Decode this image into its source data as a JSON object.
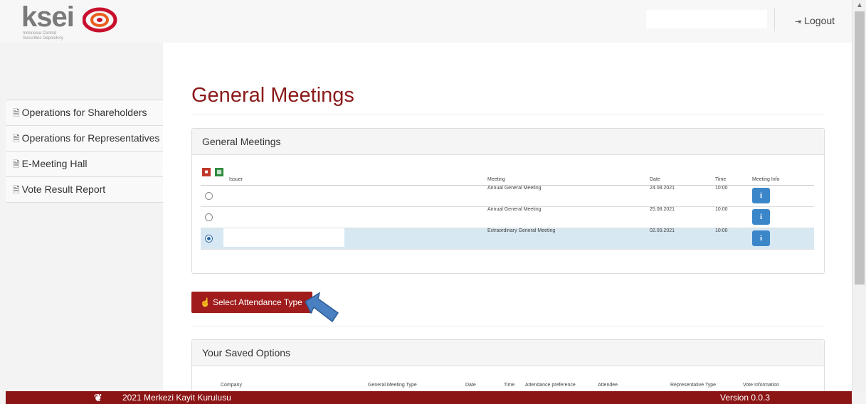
{
  "brand": {
    "logo_text": "ksei",
    "logo_sub_1": "Indonesia Central",
    "logo_sub_2": "Securities Depository"
  },
  "header": {
    "logout_label": "Logout"
  },
  "sidebar": {
    "items": [
      {
        "label": "Operations for Shareholders"
      },
      {
        "label": "Operations for Representatives"
      },
      {
        "label": "E-Meeting Hall"
      },
      {
        "label": "Vote Result Report"
      }
    ]
  },
  "main": {
    "title": "General Meetings",
    "meetings_panel": {
      "heading": "General Meetings",
      "columns": [
        "Issuer",
        "Meeting",
        "Date",
        "Time",
        "Meeting Info"
      ],
      "rows": [
        {
          "issuer": "",
          "meeting": "Annual General Meeting",
          "date": "24.08.2021",
          "time": "10:00",
          "selected": false
        },
        {
          "issuer": "",
          "meeting": "Annual General Meeting",
          "date": "25.08.2021",
          "time": "10:00",
          "selected": false
        },
        {
          "issuer": "",
          "meeting": "Extraordinary General Meeting",
          "date": "02.09.2021",
          "time": "10:00",
          "selected": true
        }
      ],
      "info_glyph": "i"
    },
    "select_button_label": "Select Attendance Type",
    "saved_panel": {
      "heading": "Your Saved Options",
      "columns": [
        "Company",
        "General Meeting Type",
        "Date",
        "Time",
        "Attendance preference",
        "Attendee",
        "Representative Type",
        "Vote Information"
      ]
    }
  },
  "footer": {
    "copyright": "2021 Merkezi Kayit Kurulusu",
    "version": "Version 0.0.3"
  },
  "colors": {
    "brand_red": "#8b1414",
    "title_red": "#8b1a1a",
    "button_red": "#a01c1c",
    "info_blue": "#3a86c8",
    "selected_row": "#d7e8f3",
    "arrow_blue": "#4a7fc1"
  }
}
